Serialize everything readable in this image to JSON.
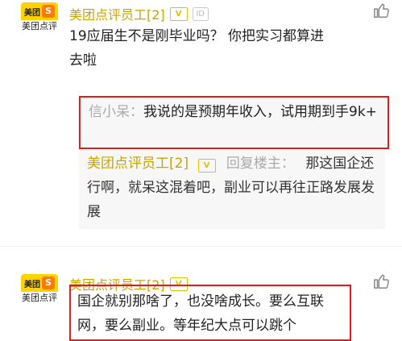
{
  "comment1": {
    "avatar": {
      "brand_top": "美团",
      "brand_mark": "S",
      "brand_bottom": "美团点评"
    },
    "username": "美团点评员工[2]",
    "vip_badge": "V",
    "id_badge": "ID",
    "text": "19应届生不是刚毕业吗？ 你把实习都算进去啦",
    "like_icon": "thumbs-up-icon"
  },
  "quoted_reply": {
    "name": "信小呆：",
    "text": "我说的是预期年收入，试用期到手9k+"
  },
  "sub_reply": {
    "username": "美团点评员工[2]",
    "vip_badge": "V",
    "reply_to": "回复楼主：",
    "text": "那这国企还行啊，就呆这混着吧，副业可以再往正路发展发展"
  },
  "comment2": {
    "avatar": {
      "brand_top": "美团",
      "brand_mark": "S",
      "brand_bottom": "美团点评"
    },
    "username": "美团点评员工[2]",
    "vip_badge": "V",
    "text": "国企就别那啥了，也没啥成长。要么互联网，要么副业。等年纪大点可以跳个",
    "like_icon": "thumbs-up-icon"
  },
  "colors": {
    "username": "#c8a600",
    "highlight_border": "#e01e1e",
    "quote_bg": "#f7f7f7"
  }
}
